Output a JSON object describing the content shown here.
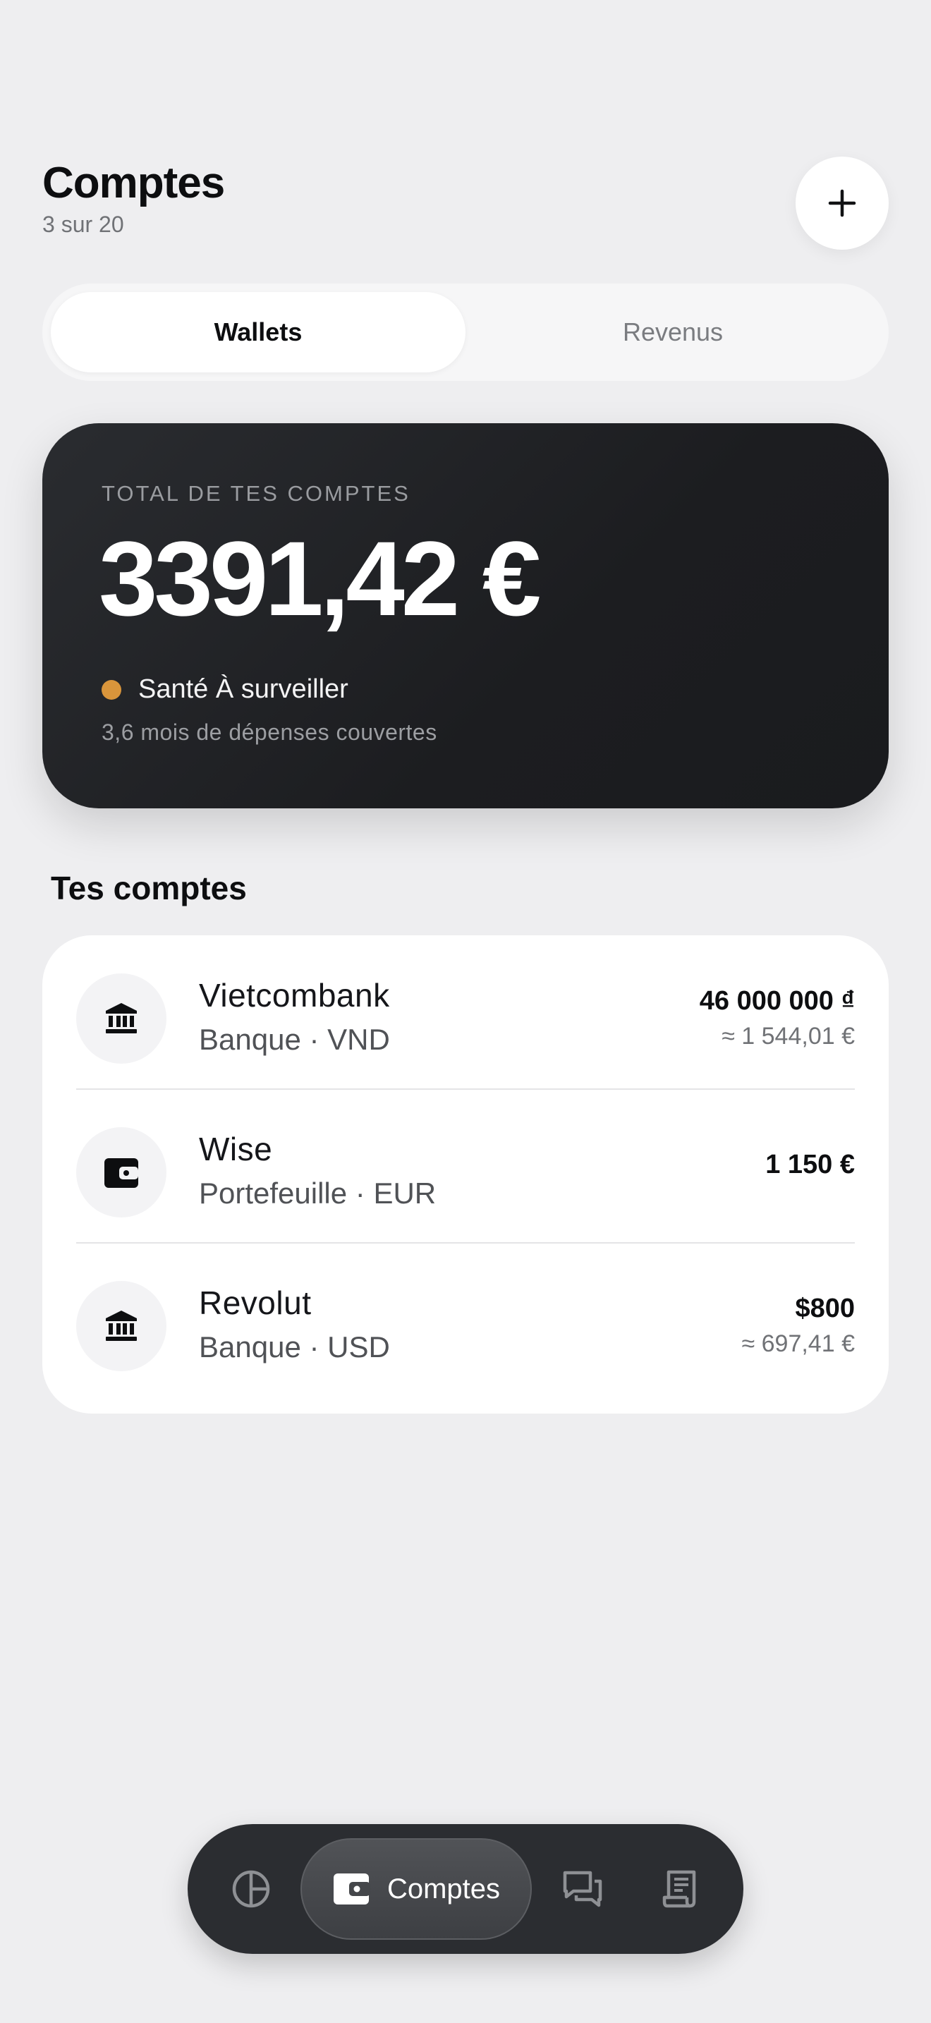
{
  "header": {
    "title": "Comptes",
    "subtitle": "3 sur 20",
    "add_icon": "plus-icon"
  },
  "tabs": [
    {
      "label": "Wallets",
      "active": true
    },
    {
      "label": "Revenus",
      "active": false
    }
  ],
  "balance": {
    "label": "TOTAL DE TES COMPTES",
    "amount": "3391,42 €",
    "health": "Santé À surveiller",
    "health_color": "#d9953b",
    "coverage": "3,6 mois de dépenses couvertes"
  },
  "accounts_section": {
    "title": "Tes comptes",
    "items": [
      {
        "name": "Vietcombank",
        "meta": "Banque · VND",
        "amount": "46 000 000 ₫",
        "converted": "≈ 1 544,01 €",
        "icon": "bank-icon"
      },
      {
        "name": "Wise",
        "meta": "Portefeuille · EUR",
        "amount": "1 150 €",
        "converted": "",
        "icon": "wallet-icon"
      },
      {
        "name": "Revolut",
        "meta": "Banque · USD",
        "amount": "$800",
        "converted": "≈ 697,41 €",
        "icon": "bank-icon"
      }
    ]
  },
  "nav": {
    "items": [
      {
        "icon": "pie-chart-icon"
      },
      {
        "label": "Comptes",
        "icon": "wallet-icon",
        "active": true
      },
      {
        "icon": "chat-icon"
      },
      {
        "icon": "receipt-icon"
      }
    ]
  },
  "colors": {
    "background": "#eeeef0",
    "card_dark": "#1e1f22",
    "accent_health": "#d9953b"
  }
}
